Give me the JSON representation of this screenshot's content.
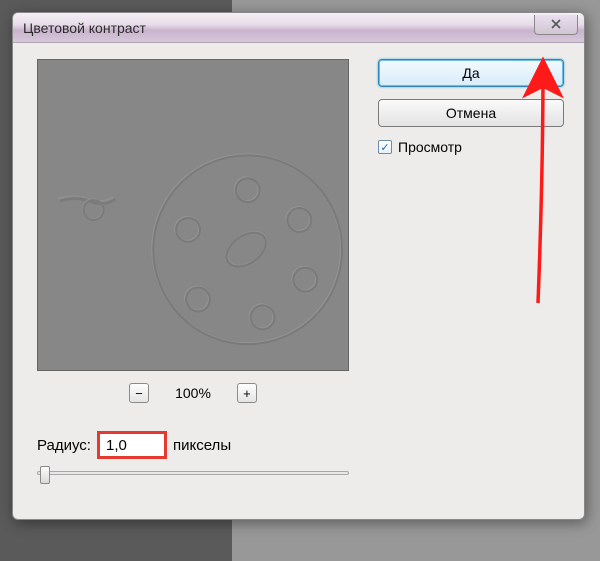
{
  "dialog": {
    "title": "Цветовой контраст",
    "zoom": {
      "minus": "−",
      "level": "100%",
      "plus": "+"
    },
    "radius": {
      "label": "Радиус:",
      "value": "1,0",
      "unit": "пикселы"
    },
    "buttons": {
      "ok": "Да",
      "cancel": "Отмена"
    },
    "preview_checkbox": {
      "label": "Просмотр",
      "checked": "✓"
    }
  }
}
